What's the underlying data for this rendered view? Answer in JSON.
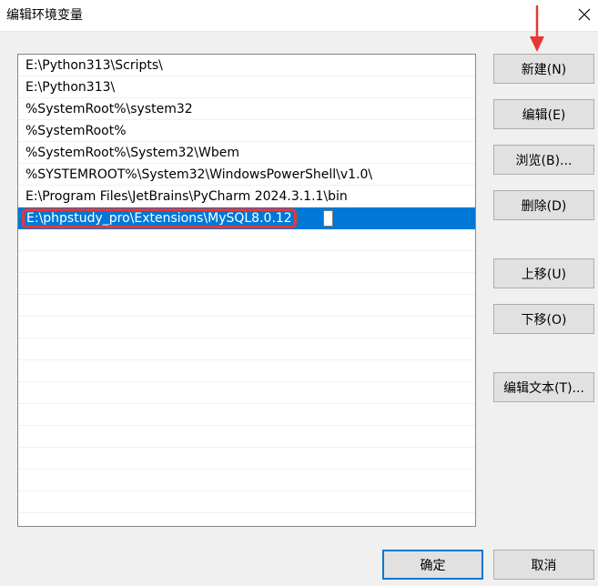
{
  "window": {
    "title": "编辑环境变量",
    "close_glyph": "✕"
  },
  "paths": [
    "E:\\Python313\\Scripts\\",
    "E:\\Python313\\",
    "%SystemRoot%\\system32",
    "%SystemRoot%",
    "%SystemRoot%\\System32\\Wbem",
    "%SYSTEMROOT%\\System32\\WindowsPowerShell\\v1.0\\",
    "E:\\Program Files\\JetBrains\\PyCharm 2024.3.1.1\\bin"
  ],
  "editing_entry": "E:\\phpstudy_pro\\Extensions\\MySQL8.0.12",
  "empty_rows": 14,
  "buttons": {
    "new": "新建(N)",
    "edit": "编辑(E)",
    "browse": "浏览(B)...",
    "delete": "删除(D)",
    "move_up": "上移(U)",
    "move_down": "下移(O)",
    "edit_text": "编辑文本(T)...",
    "ok": "确定",
    "cancel": "取消"
  },
  "colors": {
    "selection": "#0078d7",
    "highlight": "#e53935"
  }
}
